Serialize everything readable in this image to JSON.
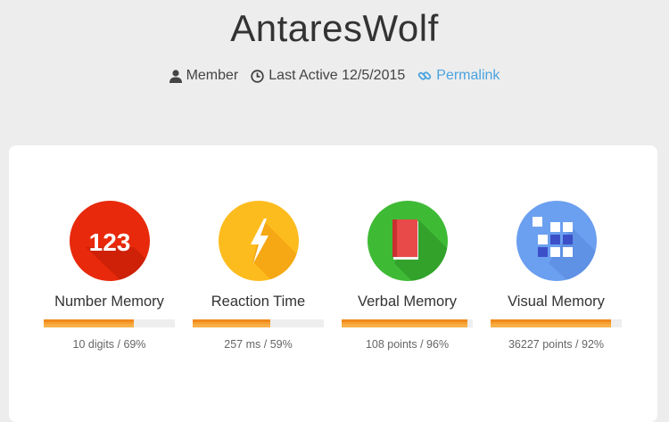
{
  "profile": {
    "username": "AntaresWolf",
    "role": "Member",
    "last_active": "Last Active 12/5/2015",
    "permalink_label": "Permalink"
  },
  "colors": {
    "number_memory": "#e8290b",
    "reaction_time": "#fdbc1e",
    "verbal_memory": "#3fba35",
    "visual_memory": "#6b9ff0",
    "bar_fill": "#f5a031",
    "link": "#4aa3df"
  },
  "stats": [
    {
      "name": "Number Memory",
      "value": "10 digits / 69%",
      "percent": 69,
      "icon": "number-123-icon",
      "icon_text": "123"
    },
    {
      "name": "Reaction Time",
      "value": "257 ms / 59%",
      "percent": 59,
      "icon": "lightning-bolt-icon"
    },
    {
      "name": "Verbal Memory",
      "value": "108 points / 96%",
      "percent": 96,
      "icon": "book-icon"
    },
    {
      "name": "Visual Memory",
      "value": "36227 points / 92%",
      "percent": 92,
      "icon": "grid-squares-icon"
    }
  ]
}
